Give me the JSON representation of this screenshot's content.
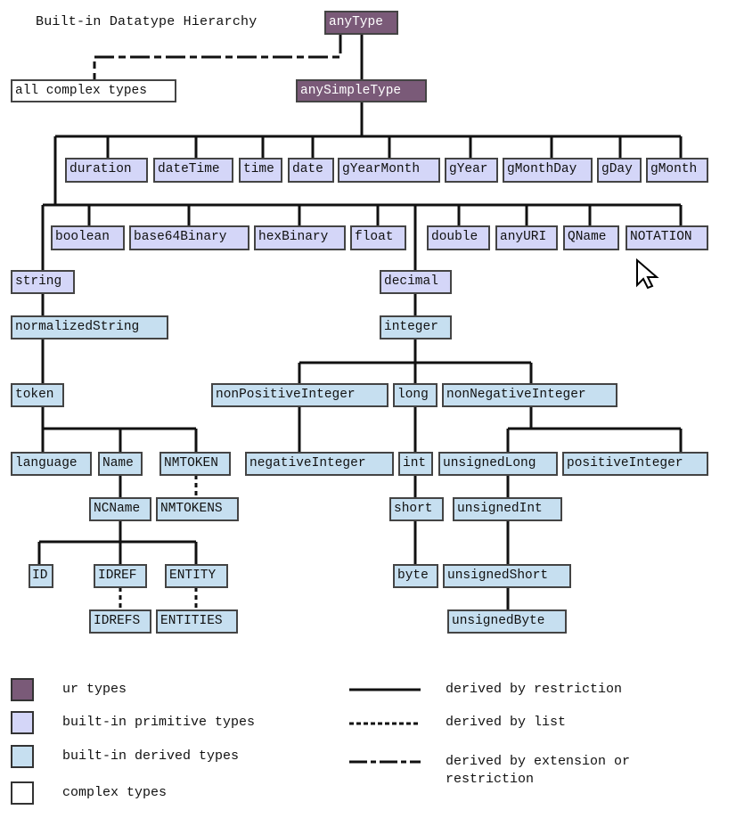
{
  "title": "Built-in Datatype Hierarchy",
  "colors": {
    "ur": "#7a5a78",
    "primitive": "#d4d6f8",
    "derived": "#c6dff0",
    "complex": "#ffffff",
    "line": "#111111"
  },
  "nodes": {
    "anyType": "anyType",
    "allComplexTypes": "all complex types",
    "anySimpleType": "anySimpleType",
    "duration": "duration",
    "dateTime": "dateTime",
    "time": "time",
    "date": "date",
    "gYearMonth": "gYearMonth",
    "gYear": "gYear",
    "gMonthDay": "gMonthDay",
    "gDay": "gDay",
    "gMonth": "gMonth",
    "boolean": "boolean",
    "base64Binary": "base64Binary",
    "hexBinary": "hexBinary",
    "float": "float",
    "double": "double",
    "anyURI": "anyURI",
    "QName": "QName",
    "NOTATION": "NOTATION",
    "string": "string",
    "decimal": "decimal",
    "normalizedString": "normalizedString",
    "integer": "integer",
    "token": "token",
    "nonPositiveInteger": "nonPositiveInteger",
    "long": "long",
    "nonNegativeInteger": "nonNegativeInteger",
    "language": "language",
    "Name": "Name",
    "NMTOKEN": "NMTOKEN",
    "negativeInteger": "negativeInteger",
    "int": "int",
    "unsignedLong": "unsignedLong",
    "positiveInteger": "positiveInteger",
    "NCName": "NCName",
    "NMTOKENS": "NMTOKENS",
    "short": "short",
    "unsignedInt": "unsignedInt",
    "ID": "ID",
    "IDREF": "IDREF",
    "ENTITY": "ENTITY",
    "byte": "byte",
    "unsignedShort": "unsignedShort",
    "IDREFS": "IDREFS",
    "ENTITIES": "ENTITIES",
    "unsignedByte": "unsignedByte"
  },
  "legend": {
    "ur": "ur types",
    "primitive": "built-in primitive types",
    "derived": "built-in derived types",
    "complex": "complex types",
    "restriction": "derived by restriction",
    "list": "derived by list",
    "extension_line1": "derived by extension or",
    "extension_line2": "restriction"
  }
}
